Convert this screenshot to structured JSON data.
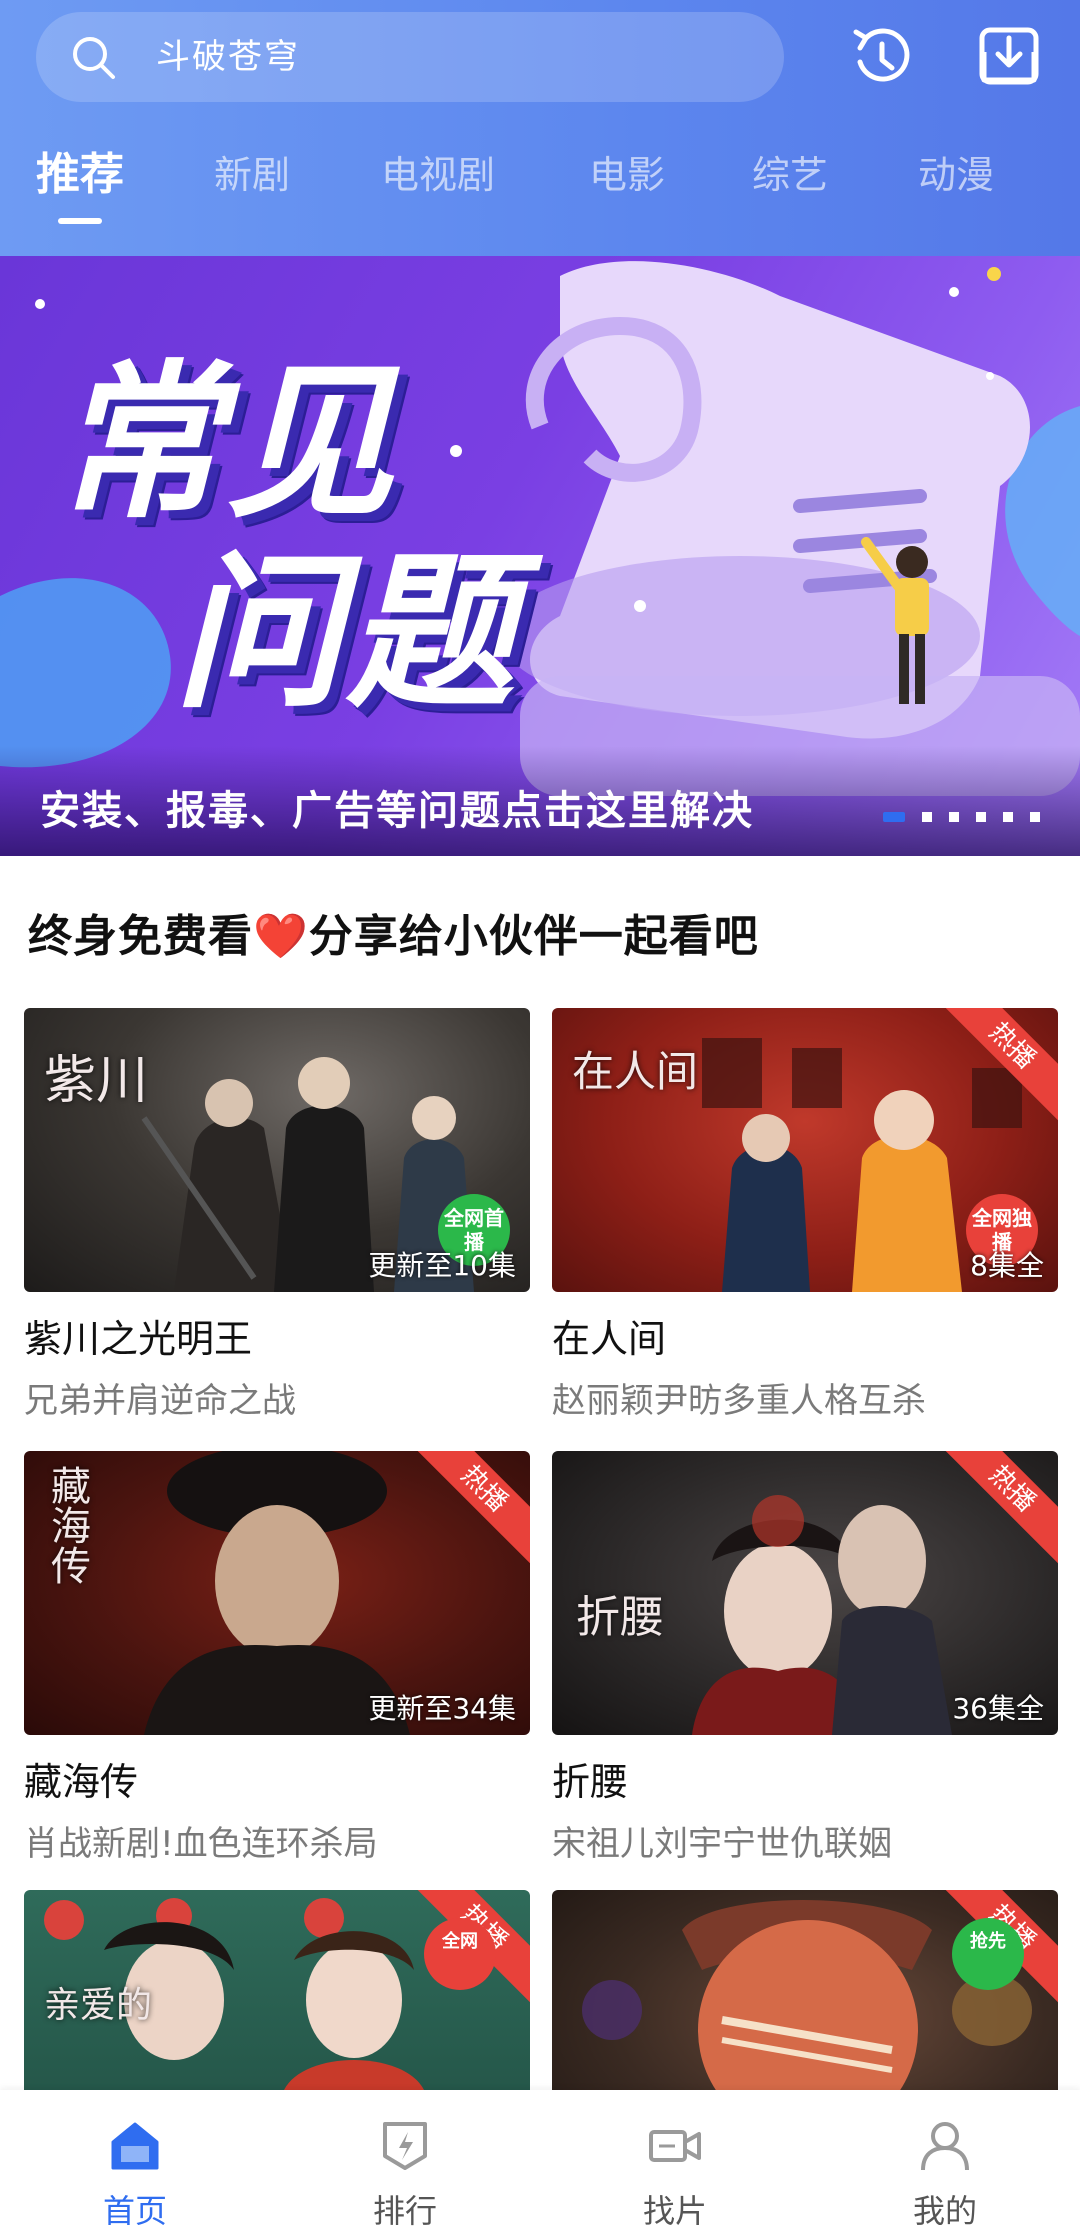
{
  "header": {
    "search_placeholder": "斗破苍穹",
    "search_icon": "search-icon",
    "history_icon": "history-icon",
    "download_icon": "download-icon",
    "tabs": [
      {
        "label": "推荐",
        "active": true
      },
      {
        "label": "新剧",
        "active": false
      },
      {
        "label": "电视剧",
        "active": false
      },
      {
        "label": "电影",
        "active": false
      },
      {
        "label": "综艺",
        "active": false
      },
      {
        "label": "动漫",
        "active": false
      }
    ]
  },
  "banner": {
    "title_line1": "常见",
    "title_line2": "问题",
    "caption": "安装、报毒、广告等问题点击这里解决",
    "slide_count": 6,
    "active_slide": 1
  },
  "section": {
    "title_prefix": "终身免费看",
    "heart": "❤️",
    "title_suffix": "分享给小伙伴一起看吧"
  },
  "cards": [
    {
      "poster_title": "紫川",
      "badge": "",
      "ribbon": "全网首播",
      "episodes": "更新至10集",
      "name": "紫川之光明王",
      "desc": "兄弟并肩逆命之战"
    },
    {
      "poster_title": "在人间",
      "badge": "热播",
      "ribbon": "全网独播",
      "episodes": "8集全",
      "name": "在人间",
      "desc": "赵丽颖尹昉多重人格互杀"
    },
    {
      "poster_title": "藏海传",
      "badge": "热播",
      "ribbon": "",
      "episodes": "更新至34集",
      "name": "藏海传",
      "desc": "肖战新剧!血色连环杀局"
    },
    {
      "poster_title": "折腰",
      "badge": "热播",
      "ribbon": "",
      "episodes": "36集全",
      "name": "折腰",
      "desc": "宋祖儿刘宇宁世仇联姻"
    },
    {
      "poster_title": "亲爱的",
      "badge": "热播",
      "ribbon": "全网",
      "episodes": "",
      "name": "",
      "desc": ""
    },
    {
      "poster_title": "",
      "badge": "热播",
      "ribbon": "抢先",
      "episodes": "",
      "name": "",
      "desc": ""
    }
  ],
  "bottom_nav": [
    {
      "label": "首页",
      "icon": "home-icon",
      "active": true
    },
    {
      "label": "排行",
      "icon": "ranking-icon",
      "active": false
    },
    {
      "label": "找片",
      "icon": "video-camera-icon",
      "active": false
    },
    {
      "label": "我的",
      "icon": "profile-icon",
      "active": false
    }
  ],
  "colors": {
    "header_blue": "#6e9bf3",
    "accent_blue": "#2f6df0",
    "hot_badge_red": "#e8413a",
    "banner_purple": "#7a3fe3"
  }
}
